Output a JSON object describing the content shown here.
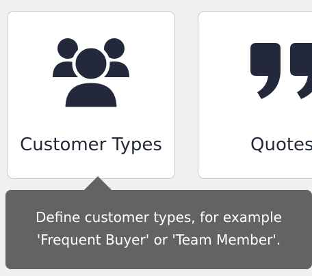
{
  "tiles": [
    {
      "label": "Customer Types",
      "icon": "users-icon"
    },
    {
      "label": "Quotes",
      "icon": "quote-icon"
    }
  ],
  "tooltip": {
    "line1": "Define customer types, for example",
    "line2": "'Frequent Buyer' or 'Team Member'."
  },
  "colors": {
    "background": "#f0f0f0",
    "tile": "#ffffff",
    "icon": "#23293a",
    "tooltip": "#636363"
  }
}
